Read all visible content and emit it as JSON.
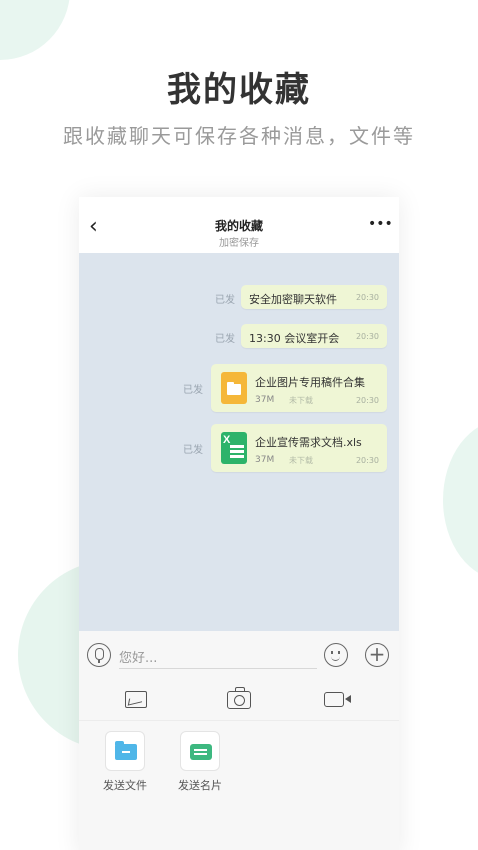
{
  "promo": {
    "headline": "我的收藏",
    "subline": "跟收藏聊天可保存各种消息，文件等"
  },
  "topbar": {
    "back_icon": "chevron-left-icon",
    "title": "我的收藏",
    "subtitle": "加密保存",
    "more_icon": "more-dots-icon"
  },
  "messages": [
    {
      "status": "已发",
      "text": "安全加密聊天软件",
      "time": "20:30"
    },
    {
      "status": "已发",
      "text": "13:30 会议室开会",
      "time": "20:30"
    }
  ],
  "files": [
    {
      "status": "已发",
      "icon": "folder-file-icon",
      "name": "企业图片专用稿件合集",
      "size": "37M",
      "state": "未下载",
      "time": "20:30"
    },
    {
      "status": "已发",
      "icon": "excel-file-icon",
      "name": "企业宣传需求文档.xls",
      "size": "37M",
      "state": "未下载",
      "time": "20:30"
    }
  ],
  "input": {
    "placeholder": "您好...",
    "voice_icon": "microphone-icon",
    "emoji_icon": "emoji-icon",
    "plus_icon": "plus-icon"
  },
  "media": {
    "image_icon": "image-icon",
    "camera_icon": "camera-icon",
    "video_icon": "video-icon"
  },
  "tools": [
    {
      "label": "发送文件",
      "icon": "folder-icon"
    },
    {
      "label": "发送名片",
      "icon": "business-card-icon"
    }
  ],
  "colors": {
    "chat_bg": "#dce4ed",
    "bubble_bg": "#eff6d5",
    "deco_green": "#e8f6f0",
    "excel_green": "#2db36a",
    "folder_yellow": "#f5b739",
    "folder_blue": "#4fb6e8"
  }
}
